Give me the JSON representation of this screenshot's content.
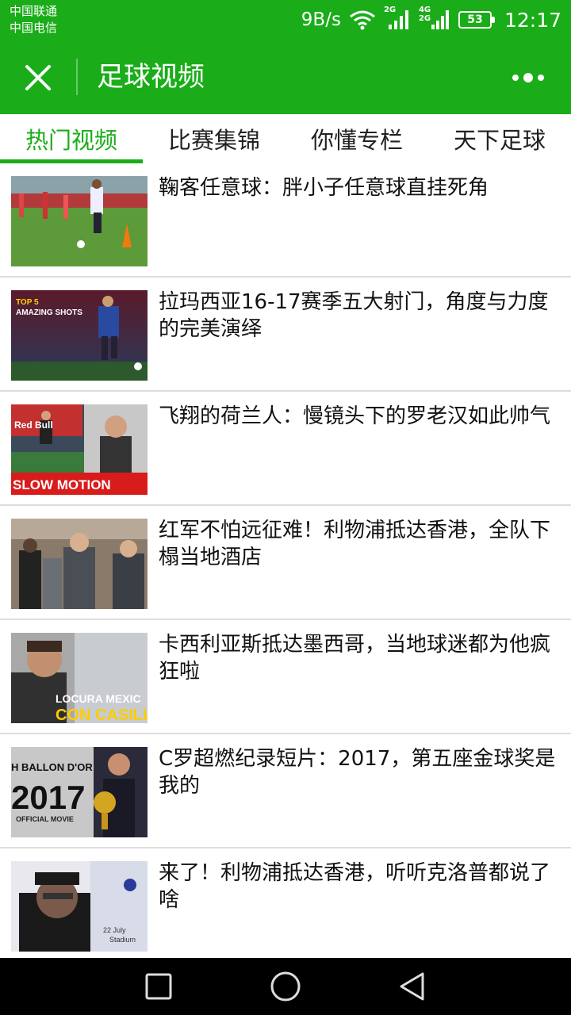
{
  "status_bar": {
    "carrier_1": "中国联通",
    "carrier_2": "中国电信",
    "net_speed": "9B/s",
    "sim1_label": "2G",
    "sim2_label_top": "4G",
    "sim2_label_bottom": "2G",
    "battery": "53",
    "time": "12:17",
    "icons": [
      "wifi-icon",
      "signal-icon",
      "battery-icon"
    ]
  },
  "header": {
    "title": "足球视频",
    "close_icon": "close-icon",
    "more_icon": "more-icon"
  },
  "tabs": [
    {
      "label": "热门视频",
      "active": true
    },
    {
      "label": "比赛集锦",
      "active": false
    },
    {
      "label": "你懂专栏",
      "active": false
    },
    {
      "label": "天下足球",
      "active": false
    }
  ],
  "videos": [
    {
      "title": "鞠客任意球：胖小子任意球直挂死角"
    },
    {
      "title": "拉玛西亚16-17赛季五大射门，角度与力度的完美演绎",
      "thumb_text_1": "TOP 5",
      "thumb_text_2": "AMAZING SHOTS"
    },
    {
      "title": "飞翔的荷兰人：慢镜头下的罗老汉如此帅气",
      "thumb_text_1": "SLOW MOTION",
      "thumb_text_2": "Red Bull"
    },
    {
      "title": "红军不怕远征难！利物浦抵达香港，全队下榻当地酒店"
    },
    {
      "title": "卡西利亚斯抵达墨西哥，当地球迷都为他疯狂啦",
      "thumb_text_1": "LOCURA MEXIC",
      "thumb_text_2": "CON CASILL"
    },
    {
      "title": "C罗超燃纪录短片：2017，第五座金球奖是我的",
      "thumb_text_1": "H BALLON D'OR",
      "thumb_text_2": "2017",
      "thumb_text_3": "OFFICIAL MOVIE"
    },
    {
      "title": "来了！利物浦抵达香港，听听克洛普都说了啥",
      "thumb_text_1": "22 July",
      "thumb_text_2": "Stadium"
    }
  ],
  "nav_bar": {
    "recent_icon": "square-icon",
    "home_icon": "circle-icon",
    "back_icon": "triangle-back-icon"
  },
  "colors": {
    "brand_green": "#1aad19",
    "text": "#111111",
    "divider": "#dddddd",
    "nav_bg": "#000000"
  }
}
